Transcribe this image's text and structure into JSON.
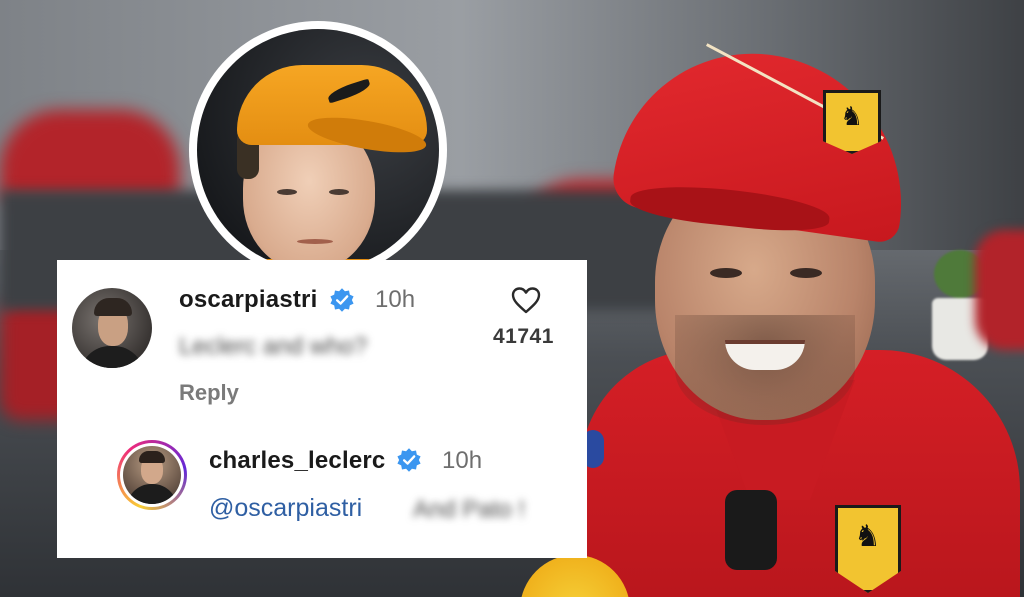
{
  "comments": [
    {
      "username": "oscarpiastri",
      "verified": true,
      "timestamp": "10h",
      "text": "Leclerc and who?",
      "reply_label": "Reply",
      "likes": "41741"
    },
    {
      "username": "charles_leclerc",
      "verified": true,
      "timestamp": "10h",
      "mention": "@oscarpiastri",
      "text": "And Pato !"
    }
  ],
  "icons": {
    "verified": "verified-badge-icon",
    "like": "heart-icon"
  },
  "colors": {
    "verified_blue": "#3b96f0",
    "mention_blue": "#2f5fa3",
    "card_bg": "#ffffff",
    "ferrari_red": "#d51f26",
    "mclaren_papaya": "#f6a623"
  }
}
